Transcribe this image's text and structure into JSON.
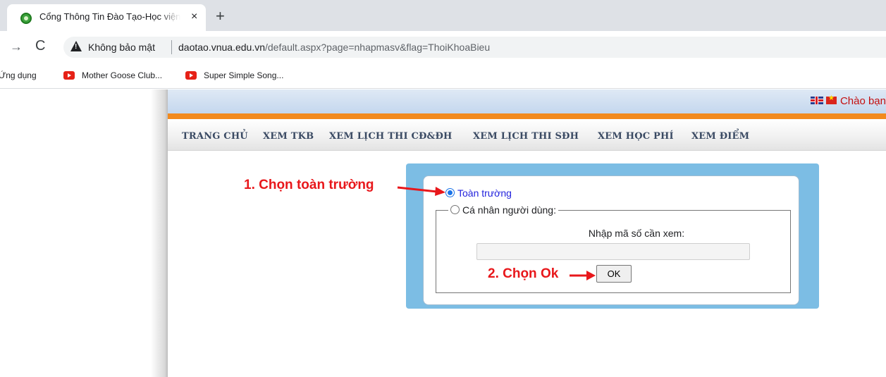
{
  "browser": {
    "tab_title": "Cổng Thông Tin Đào Tạo-Học viện",
    "tab_close": "×",
    "new_tab": "+",
    "forward": "→",
    "reload": "C",
    "security_label": "Không bảo mật",
    "url_host": "daotao.vnua.edu.vn",
    "url_path": "/default.aspx?page=nhapmasv&flag=ThoiKhoaBieu",
    "bookmarks": [
      {
        "label": "Ứng dụng"
      },
      {
        "label": "Mother Goose Club..."
      },
      {
        "label": "Super Simple Song..."
      }
    ]
  },
  "header": {
    "greeting": "Chào bạn"
  },
  "menu": {
    "items": [
      {
        "label": "TRANG CHỦ"
      },
      {
        "label": "XEM TKB"
      },
      {
        "label": "XEM LỊCH THI CĐ&ĐH"
      },
      {
        "label": "XEM LỊCH THI SĐH"
      },
      {
        "label": "XEM HỌC PHÍ"
      },
      {
        "label": "XEM ĐIỂM"
      }
    ]
  },
  "form": {
    "option_all": "Toàn trường",
    "option_all_checked": true,
    "option_personal": "Cá nhân người dùng:",
    "option_personal_checked": false,
    "code_label": "Nhập mã số cần xem:",
    "code_value": "",
    "ok_label": "OK"
  },
  "annotations": {
    "step1": "1. Chọn toàn trường",
    "step2": "2. Chọn Ok",
    "color": "#e8171b"
  },
  "colors": {
    "panel": "#7cbde4",
    "orange_bar": "#f28a1e",
    "menu_text": "#3a4a63",
    "greeting": "#c40f0f"
  }
}
